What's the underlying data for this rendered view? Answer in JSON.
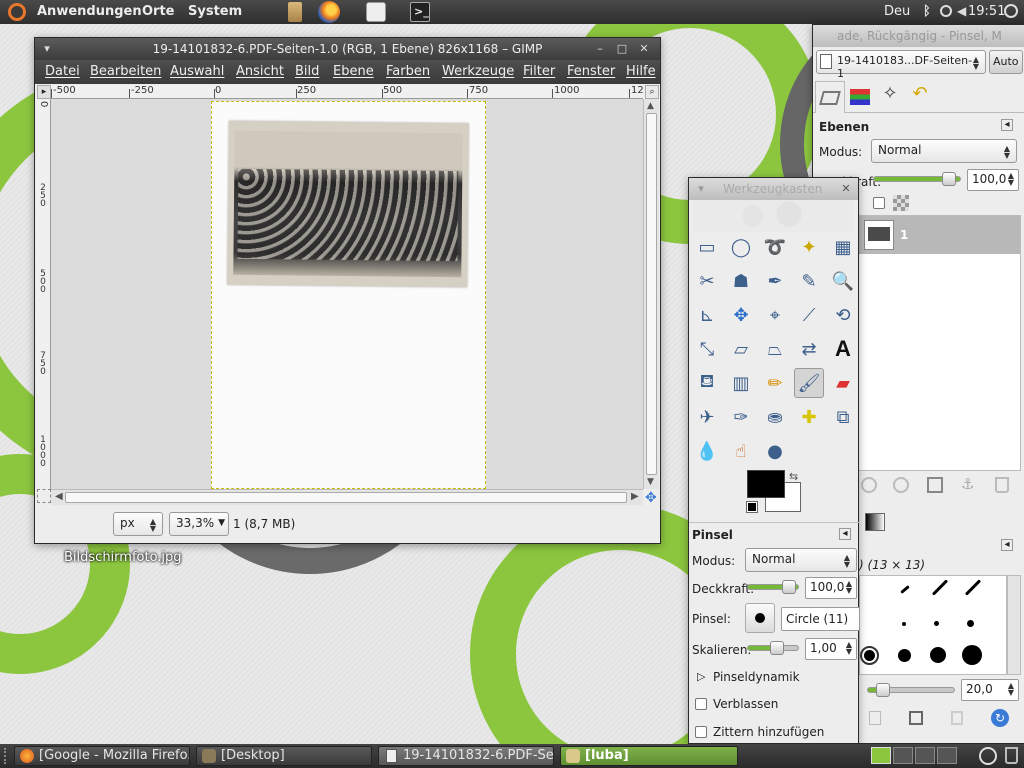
{
  "top_panel": {
    "menus": [
      "Anwendungen",
      "Orte",
      "System"
    ],
    "keyboard_layout": "Deu",
    "clock": "19:51",
    "launchers": [
      "file-manager-icon",
      "firefox-icon",
      "notes-icon",
      "terminal-icon"
    ]
  },
  "desktop": {
    "file_label": "Bildschirmfoto.jpg",
    "accent_green": "#8cc63f"
  },
  "gimp_window": {
    "title": "19-14101832-6.PDF-Seiten-1.0 (RGB, 1 Ebene) 826x1168 – GIMP",
    "menu": [
      "Datei",
      "Bearbeiten",
      "Auswahl",
      "Ansicht",
      "Bild",
      "Ebene",
      "Farben",
      "Werkzeuge",
      "Filter",
      "Fenster",
      "Hilfe"
    ],
    "h_ruler_labels": [
      "-500",
      "-250",
      "0",
      "250",
      "500",
      "750",
      "1000",
      "12"
    ],
    "v_ruler_labels": [
      "0",
      "250",
      "500",
      "750",
      "1000"
    ],
    "status": {
      "unit": "px",
      "zoom": "33,3%",
      "info": "1 (8,7 MB)"
    }
  },
  "layers_dock": {
    "title": "ade, Rückgängig - Pinsel, M",
    "image_select": "19-1410183...DF-Seiten-1",
    "auto_button": "Auto",
    "section_title": "Ebenen",
    "mode_label": "Modus:",
    "mode_value": "Normal",
    "opacity_label": "Deckkraft:",
    "opacity_value": "100,0",
    "layer_name": "1",
    "brushes_caption": ") (13 × 13)",
    "spacing_value": "20,0"
  },
  "toolbox": {
    "title": "Werkzeugkasten",
    "tools": [
      "rect-select-icon",
      "ellipse-select-icon",
      "free-select-icon",
      "fuzzy-select-icon",
      "color-select-icon",
      "scissors-icon",
      "foreground-select-icon",
      "paths-icon",
      "color-picker-icon",
      "zoom-icon",
      "measure-icon",
      "move-icon",
      "align-icon",
      "crop-icon",
      "rotate-icon",
      "scale-icon",
      "shear-icon",
      "perspective-icon",
      "flip-icon",
      "text-icon",
      "bucket-fill-icon",
      "blend-icon",
      "pencil-icon",
      "paintbrush-icon",
      "eraser-icon",
      "airbrush-icon",
      "ink-icon",
      "clone-icon",
      "heal-icon",
      "perspective-clone-icon",
      "blur-icon",
      "smudge-icon",
      "dodge-burn-icon"
    ],
    "fg_color": "#000000",
    "bg_color": "#ffffff",
    "options": {
      "section": "Pinsel",
      "mode_label": "Modus:",
      "mode_value": "Normal",
      "opacity_label": "Deckkraft:",
      "opacity_value": "100,0",
      "brush_label": "Pinsel:",
      "brush_value": "Circle (11)",
      "scale_label": "Skalieren:",
      "scale_value": "1,00",
      "dynamics_label": "Pinseldynamik",
      "fade_label": "Verblassen",
      "jitter_label": "Zittern hinzufügen"
    }
  },
  "taskbar": {
    "items": [
      "[Google - Mozilla Firefo...",
      "[Desktop]",
      "19-14101832-6.PDF-Sei...",
      "[luba]"
    ]
  }
}
